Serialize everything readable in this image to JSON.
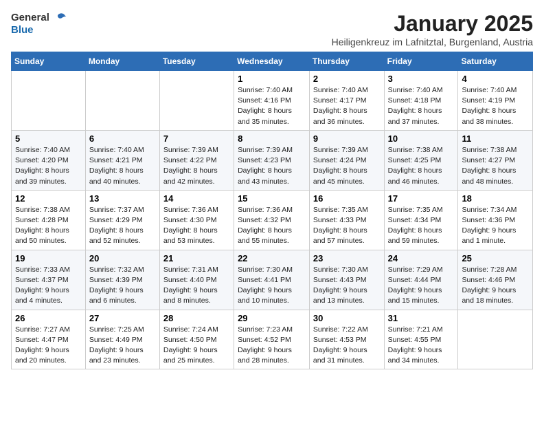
{
  "logo": {
    "general": "General",
    "blue": "Blue"
  },
  "title": "January 2025",
  "subtitle": "Heiligenkreuz im Lafnitztal, Burgenland, Austria",
  "headers": [
    "Sunday",
    "Monday",
    "Tuesday",
    "Wednesday",
    "Thursday",
    "Friday",
    "Saturday"
  ],
  "weeks": [
    [
      {
        "day": "",
        "info": ""
      },
      {
        "day": "",
        "info": ""
      },
      {
        "day": "",
        "info": ""
      },
      {
        "day": "1",
        "info": "Sunrise: 7:40 AM\nSunset: 4:16 PM\nDaylight: 8 hours and 35 minutes."
      },
      {
        "day": "2",
        "info": "Sunrise: 7:40 AM\nSunset: 4:17 PM\nDaylight: 8 hours and 36 minutes."
      },
      {
        "day": "3",
        "info": "Sunrise: 7:40 AM\nSunset: 4:18 PM\nDaylight: 8 hours and 37 minutes."
      },
      {
        "day": "4",
        "info": "Sunrise: 7:40 AM\nSunset: 4:19 PM\nDaylight: 8 hours and 38 minutes."
      }
    ],
    [
      {
        "day": "5",
        "info": "Sunrise: 7:40 AM\nSunset: 4:20 PM\nDaylight: 8 hours and 39 minutes."
      },
      {
        "day": "6",
        "info": "Sunrise: 7:40 AM\nSunset: 4:21 PM\nDaylight: 8 hours and 40 minutes."
      },
      {
        "day": "7",
        "info": "Sunrise: 7:39 AM\nSunset: 4:22 PM\nDaylight: 8 hours and 42 minutes."
      },
      {
        "day": "8",
        "info": "Sunrise: 7:39 AM\nSunset: 4:23 PM\nDaylight: 8 hours and 43 minutes."
      },
      {
        "day": "9",
        "info": "Sunrise: 7:39 AM\nSunset: 4:24 PM\nDaylight: 8 hours and 45 minutes."
      },
      {
        "day": "10",
        "info": "Sunrise: 7:38 AM\nSunset: 4:25 PM\nDaylight: 8 hours and 46 minutes."
      },
      {
        "day": "11",
        "info": "Sunrise: 7:38 AM\nSunset: 4:27 PM\nDaylight: 8 hours and 48 minutes."
      }
    ],
    [
      {
        "day": "12",
        "info": "Sunrise: 7:38 AM\nSunset: 4:28 PM\nDaylight: 8 hours and 50 minutes."
      },
      {
        "day": "13",
        "info": "Sunrise: 7:37 AM\nSunset: 4:29 PM\nDaylight: 8 hours and 52 minutes."
      },
      {
        "day": "14",
        "info": "Sunrise: 7:36 AM\nSunset: 4:30 PM\nDaylight: 8 hours and 53 minutes."
      },
      {
        "day": "15",
        "info": "Sunrise: 7:36 AM\nSunset: 4:32 PM\nDaylight: 8 hours and 55 minutes."
      },
      {
        "day": "16",
        "info": "Sunrise: 7:35 AM\nSunset: 4:33 PM\nDaylight: 8 hours and 57 minutes."
      },
      {
        "day": "17",
        "info": "Sunrise: 7:35 AM\nSunset: 4:34 PM\nDaylight: 8 hours and 59 minutes."
      },
      {
        "day": "18",
        "info": "Sunrise: 7:34 AM\nSunset: 4:36 PM\nDaylight: 9 hours and 1 minute."
      }
    ],
    [
      {
        "day": "19",
        "info": "Sunrise: 7:33 AM\nSunset: 4:37 PM\nDaylight: 9 hours and 4 minutes."
      },
      {
        "day": "20",
        "info": "Sunrise: 7:32 AM\nSunset: 4:39 PM\nDaylight: 9 hours and 6 minutes."
      },
      {
        "day": "21",
        "info": "Sunrise: 7:31 AM\nSunset: 4:40 PM\nDaylight: 9 hours and 8 minutes."
      },
      {
        "day": "22",
        "info": "Sunrise: 7:30 AM\nSunset: 4:41 PM\nDaylight: 9 hours and 10 minutes."
      },
      {
        "day": "23",
        "info": "Sunrise: 7:30 AM\nSunset: 4:43 PM\nDaylight: 9 hours and 13 minutes."
      },
      {
        "day": "24",
        "info": "Sunrise: 7:29 AM\nSunset: 4:44 PM\nDaylight: 9 hours and 15 minutes."
      },
      {
        "day": "25",
        "info": "Sunrise: 7:28 AM\nSunset: 4:46 PM\nDaylight: 9 hours and 18 minutes."
      }
    ],
    [
      {
        "day": "26",
        "info": "Sunrise: 7:27 AM\nSunset: 4:47 PM\nDaylight: 9 hours and 20 minutes."
      },
      {
        "day": "27",
        "info": "Sunrise: 7:25 AM\nSunset: 4:49 PM\nDaylight: 9 hours and 23 minutes."
      },
      {
        "day": "28",
        "info": "Sunrise: 7:24 AM\nSunset: 4:50 PM\nDaylight: 9 hours and 25 minutes."
      },
      {
        "day": "29",
        "info": "Sunrise: 7:23 AM\nSunset: 4:52 PM\nDaylight: 9 hours and 28 minutes."
      },
      {
        "day": "30",
        "info": "Sunrise: 7:22 AM\nSunset: 4:53 PM\nDaylight: 9 hours and 31 minutes."
      },
      {
        "day": "31",
        "info": "Sunrise: 7:21 AM\nSunset: 4:55 PM\nDaylight: 9 hours and 34 minutes."
      },
      {
        "day": "",
        "info": ""
      }
    ]
  ]
}
